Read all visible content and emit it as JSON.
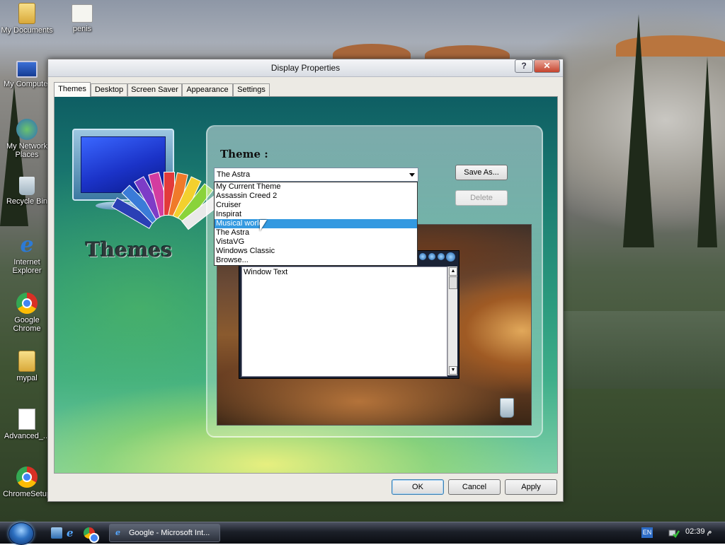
{
  "desktop": {
    "icons": [
      {
        "label": "My Documents",
        "icon": "folder-icon"
      },
      {
        "label": "penis",
        "icon": "certificate-icon"
      },
      {
        "label": "My Computer",
        "icon": "computer-icon"
      },
      {
        "label": "My Network Places",
        "icon": "network-icon"
      },
      {
        "label": "Recycle Bin",
        "icon": "recycle-bin-icon"
      },
      {
        "label": "Internet Explorer",
        "icon": "ie-icon"
      },
      {
        "label": "Google Chrome",
        "icon": "chrome-icon"
      },
      {
        "label": "mypal",
        "icon": "folder-icon"
      },
      {
        "label": "Advanced_...",
        "icon": "document-icon"
      },
      {
        "label": "ChromeSetup",
        "icon": "setup-icon"
      }
    ]
  },
  "dialog": {
    "title": "Display Properties",
    "help_button": "?",
    "close_button": "✕",
    "tabs": [
      "Themes",
      "Desktop",
      "Screen Saver",
      "Appearance",
      "Settings"
    ],
    "active_tab": "Themes",
    "logo_text": "Themes",
    "theme_label": "Theme :",
    "theme_selected": "The Astra",
    "theme_options": [
      "My Current Theme",
      "Assassin Creed 2",
      "Cruiser",
      "Inspirat",
      "Musical world",
      "The Astra",
      "VistaVG",
      "Windows Classic",
      "Browse..."
    ],
    "highlighted_option": "Musical world",
    "save_as_label": "Save As...",
    "delete_label": "Delete",
    "preview_window_text": "Window Text",
    "ok_label": "OK",
    "cancel_label": "Cancel",
    "apply_label": "Apply"
  },
  "taskbar": {
    "task_button_label": "Google - Microsoft Int...",
    "language": "EN",
    "clock": "02:39 م"
  },
  "colors": {
    "selection": "#3399e0",
    "close_button": "#c5432d"
  }
}
